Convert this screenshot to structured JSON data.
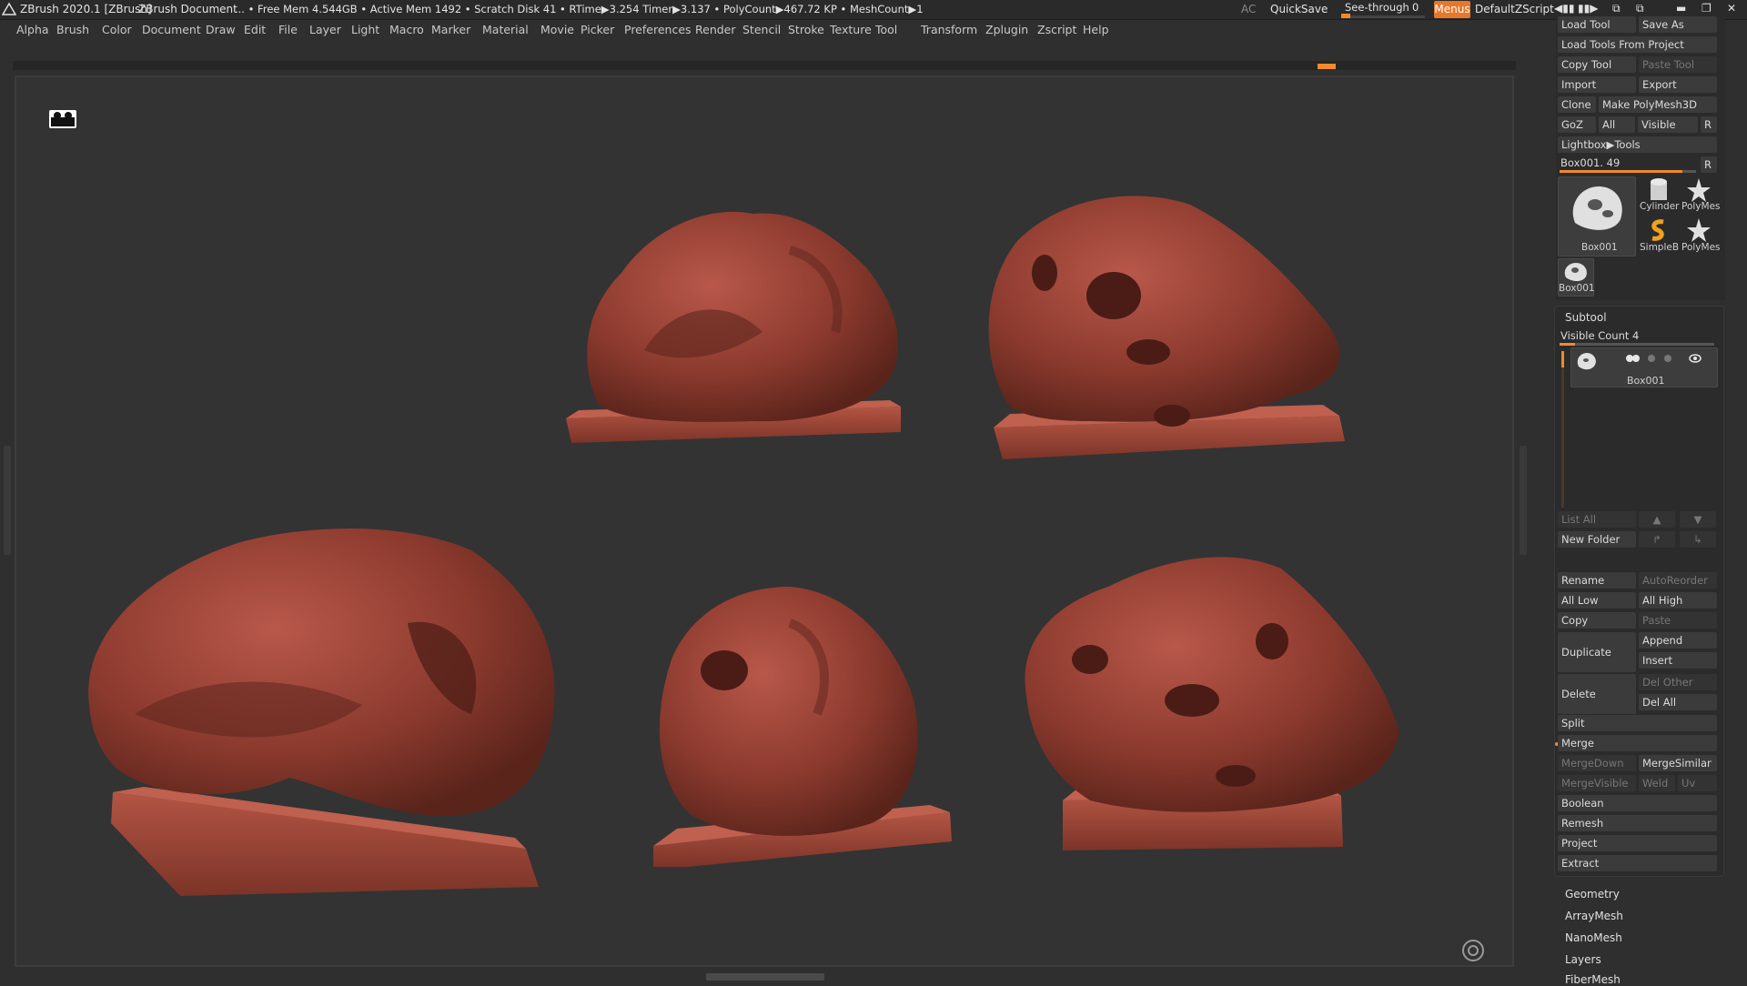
{
  "titlebar": {
    "app_title": "ZBrush 2020.1 [ZBrush]",
    "document": "ZBrush Document",
    "stats": "... • Free Mem 4.544GB • Active Mem 1492 • Scratch Disk 41 •  RTime▶3.254 Timer▶3.137 • PolyCount▶467.72 KP  • MeshCount▶1",
    "ac": "AC",
    "quicksave": "QuickSave",
    "see_through_label": "See-through",
    "see_through_value": "0",
    "see_through_level": 0,
    "menus": "Menus",
    "default_zscript": "DefaultZScript",
    "icons": [
      "zoom-in-icon",
      "zoom-out-icon",
      "layout-icon",
      "floating-palette-icon",
      "minimize-icon",
      "maximize-icon",
      "close-icon"
    ]
  },
  "menubar": [
    "Alpha",
    "Brush",
    "Color",
    "Document",
    "Draw",
    "Edit",
    "File",
    "Layer",
    "Light",
    "Macro",
    "Marker",
    "Material",
    "Movie",
    "Picker",
    "Preferences",
    "Render",
    "Stencil",
    "Stroke",
    "Texture",
    "Tool",
    "Transform",
    "Zplugin",
    "Zscript",
    "Help"
  ],
  "tool_panel": {
    "load_tool": "Load Tool",
    "save_as": "Save As",
    "load_tools_from_project": "Load Tools From Project",
    "copy_tool": "Copy Tool",
    "paste_tool": "Paste Tool",
    "import": "Import",
    "export": "Export",
    "clone": "Clone",
    "make_polymesh3d": "Make PolyMesh3D",
    "goz": "GoZ",
    "all": "All",
    "visible": "Visible",
    "r": "R",
    "lightbox_tools": "Lightbox▶Tools",
    "current_tool": "Box001. 49",
    "current_tool_level": 0.9,
    "thumbs": {
      "main": "Box001",
      "cylinder": "Cylinder",
      "polymesh1": "PolyMes",
      "simpleb": "SimpleB",
      "polymesh2": "PolyMes",
      "small": "Box001"
    }
  },
  "subtool": {
    "title": "Subtool",
    "visible_count": "Visible Count 4",
    "visible_count_level": 0.1,
    "item_name": "Box001",
    "list_all": "List All",
    "new_folder": "New Folder",
    "rename": "Rename",
    "autoreorder": "AutoReorder",
    "all_low": "All Low",
    "all_high": "All High",
    "copy": "Copy",
    "paste": "Paste",
    "duplicate": "Duplicate",
    "append": "Append",
    "insert": "Insert",
    "delete": "Delete",
    "del_other": "Del Other",
    "del_all": "Del All",
    "split": "Split",
    "merge": "Merge",
    "mergedown": "MergeDown",
    "mergesimilar": "MergeSimilar",
    "mergevisible": "MergeVisible",
    "weld": "Weld",
    "uv": "Uv",
    "boolean": "Boolean",
    "remesh": "Remesh",
    "project": "Project",
    "extract": "Extract"
  },
  "sections": [
    "Geometry",
    "ArrayMesh",
    "NanoMesh",
    "Layers",
    "FiberMesh"
  ],
  "colors": {
    "accent": "#f08a2a",
    "sculpt": "#a34a3a",
    "sculpt_dark": "#6e2c22",
    "canvas": "#333333"
  }
}
